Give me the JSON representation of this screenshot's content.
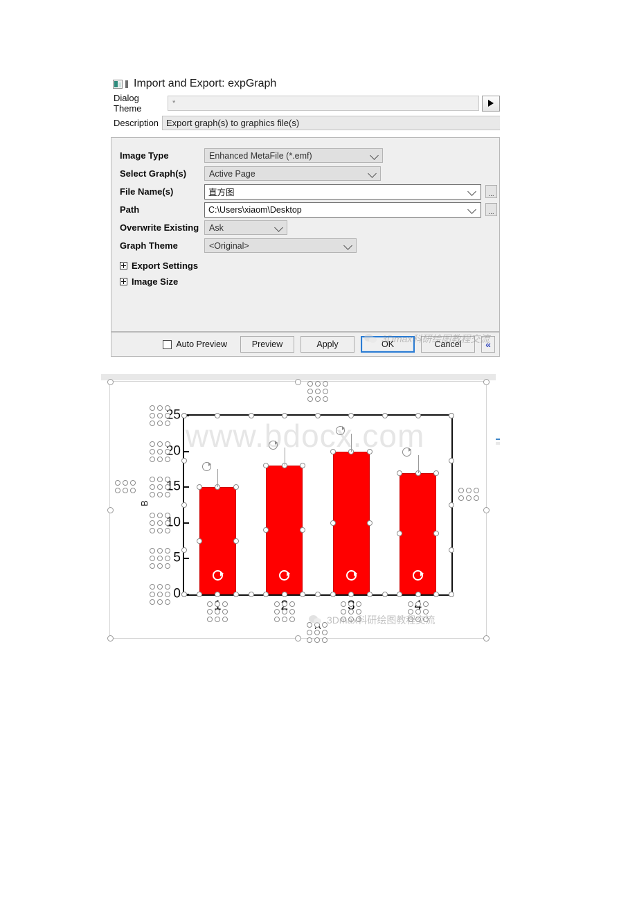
{
  "dialog": {
    "title": "Import and Export: expGraph",
    "title_icon": "graph-icon",
    "theme": {
      "label": "Dialog Theme",
      "value": "*",
      "arrow_icon": "play-arrow-icon"
    },
    "description": {
      "label": "Description",
      "value": "Export graph(s) to graphics file(s)"
    },
    "fields": [
      {
        "label": "Image Type",
        "value": "Enhanced MetaFile (*.emf)",
        "kind": "combo"
      },
      {
        "label": "Select Graph(s)",
        "value": "Active Page",
        "kind": "combo"
      },
      {
        "label": "File Name(s)",
        "value": "直方图",
        "kind": "text"
      },
      {
        "label": "Path",
        "value": "C:\\Users\\xiaom\\Desktop",
        "kind": "text"
      },
      {
        "label": "Overwrite Existing",
        "value": "Ask",
        "kind": "combo"
      },
      {
        "label": "Graph Theme",
        "value": "<Original>",
        "kind": "combo"
      }
    ],
    "browse_label": "...",
    "sections": [
      {
        "label": "Export Settings",
        "expanded": false
      },
      {
        "label": "Image Size",
        "expanded": false
      }
    ],
    "footer": {
      "auto_preview_label": "Auto Preview",
      "auto_preview_checked": false,
      "buttons": [
        {
          "label": "Preview",
          "focused": false
        },
        {
          "label": "Apply",
          "focused": false
        },
        {
          "label": "OK",
          "focused": true
        },
        {
          "label": "Cancel",
          "focused": false
        }
      ],
      "collapse_label": "«"
    }
  },
  "watermarks": {
    "wechat_text": "3Dmax科研绘图教程交流",
    "site_text": "www.bdocx.com"
  },
  "chart_data": {
    "type": "bar",
    "title": "",
    "categories": [
      "1",
      "2",
      "3",
      "4"
    ],
    "values": [
      15,
      18,
      20,
      17
    ],
    "xlabel": "A",
    "ylabel": "B",
    "ylim": [
      0,
      25
    ],
    "yticks": [
      0,
      5,
      10,
      15,
      20,
      25
    ],
    "grid": false,
    "legend": "none",
    "bar_color": "#FF0000",
    "axis_color": "#111111",
    "selected": true
  }
}
